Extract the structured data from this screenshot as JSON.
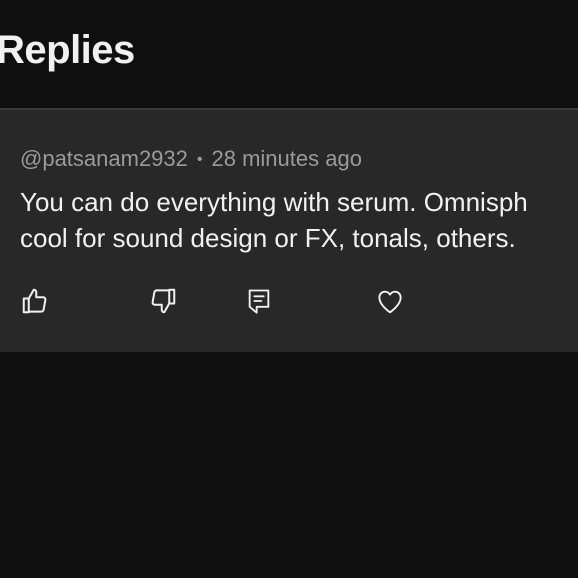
{
  "header": {
    "title": "Replies"
  },
  "reply": {
    "author": "@patsanam2932",
    "separator": "•",
    "time": "28 minutes ago",
    "line1": "You can do everything with serum. Omnisph",
    "line2": "cool for sound design or FX, tonals, others."
  },
  "actions": {
    "icons": [
      "thumbs-up-icon",
      "thumbs-down-icon",
      "reply-comment-icon",
      "heart-icon"
    ]
  },
  "colors": {
    "background": "#0f0f0f",
    "card": "#282828",
    "text_primary": "#f1f1f1",
    "text_secondary": "#9a9a9a"
  }
}
